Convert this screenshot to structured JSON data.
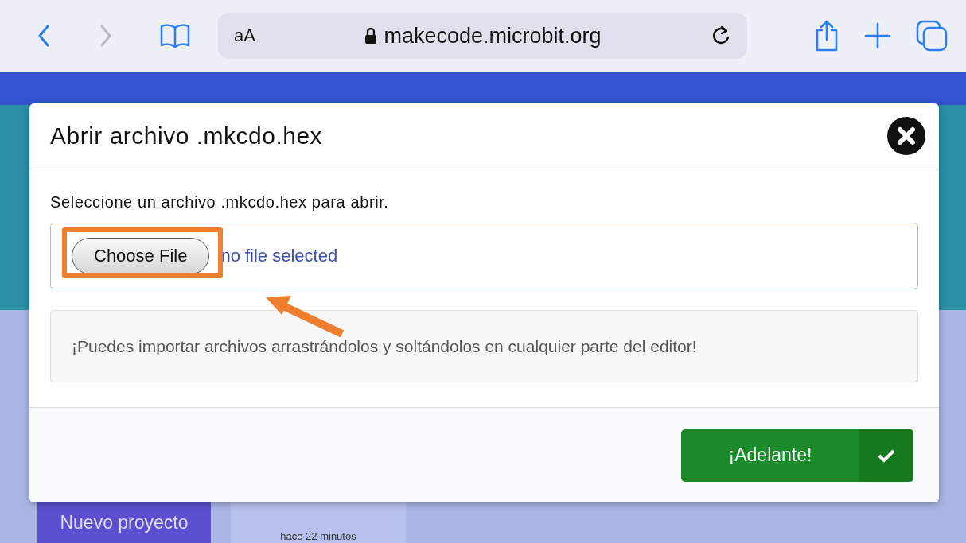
{
  "browser": {
    "nav_buttons": [
      {
        "kind": "back",
        "disabled": false
      },
      {
        "kind": "forward",
        "disabled": true
      }
    ],
    "text_size": "aA",
    "url": "makecode.microbit.org"
  },
  "dialog": {
    "title": "Abrir archivo .mkcdo.hex",
    "prompt": "Seleccione un archivo .mkcdo.hex para abrir.",
    "file_input": {
      "button": "Choose File",
      "status": "no file selected"
    },
    "info": "¡Puedes importar archivos arrastrándolos y soltándolos en cualquier parte del editor!",
    "confirm_button": "¡Adelante!"
  },
  "background": {
    "new_project": "Nuevo proyecto",
    "project_time": "hace 22 minutos"
  }
}
